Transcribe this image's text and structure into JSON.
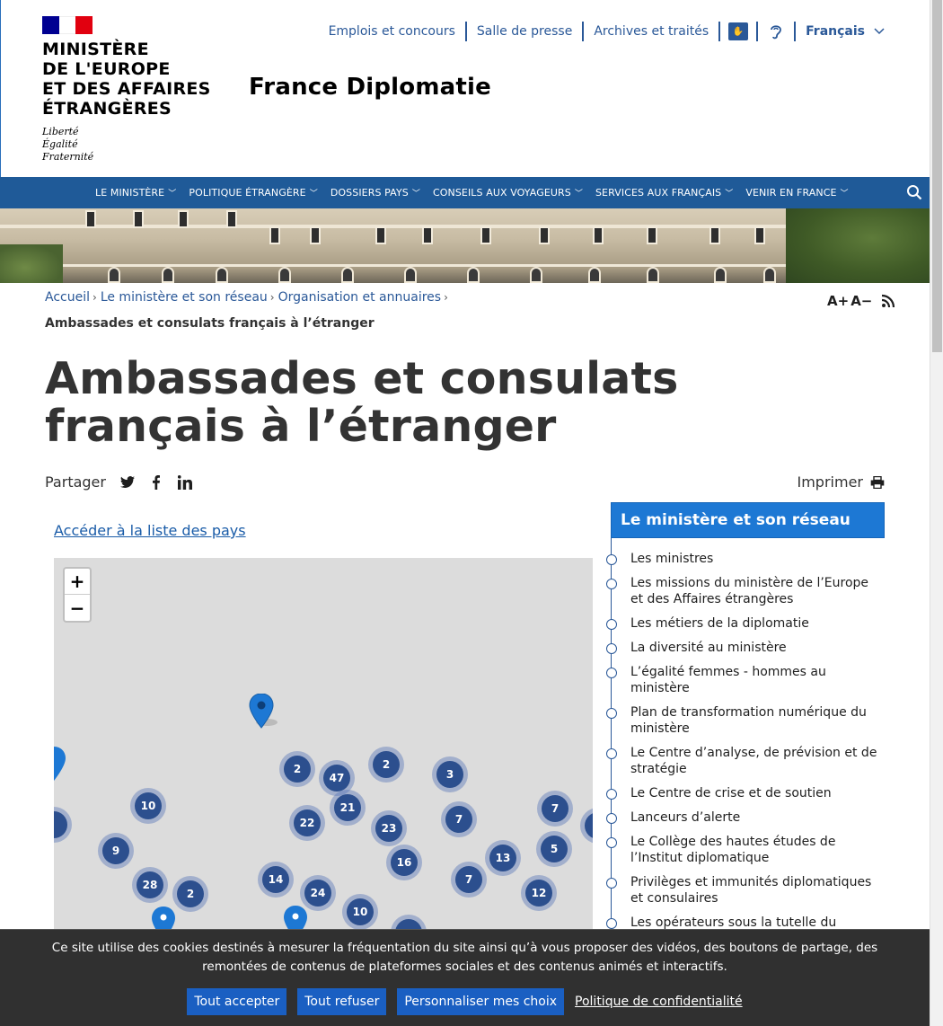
{
  "header": {
    "ministry_lines": [
      "MINISTÈRE",
      "DE L'EUROPE",
      "ET DES AFFAIRES",
      "ÉTRANGÈRES"
    ],
    "motto_lines": [
      "Liberté",
      "Égalité",
      "Fraternité"
    ],
    "site_name": "France Diplomatie",
    "top_links": [
      "Emplois et concours",
      "Salle de presse",
      "Archives et traités"
    ],
    "language": "Français"
  },
  "nav": {
    "items": [
      "LE MINISTÈRE",
      "POLITIQUE ÉTRANGÈRE",
      "DOSSIERS PAYS",
      "CONSEILS AUX VOYAGEURS",
      "SERVICES AUX FRANÇAIS",
      "VENIR EN FRANCE"
    ]
  },
  "breadcrumb": {
    "items": [
      "Accueil",
      "Le ministère et son réseau",
      "Organisation et annuaires"
    ],
    "current": "Ambassades et consulats français à l’étranger"
  },
  "tools": {
    "font_increase": "A+",
    "font_decrease": "A−"
  },
  "page": {
    "title": "Ambassades et consulats français à l’étranger",
    "share_label": "Partager",
    "print_label": "Imprimer",
    "country_list_link": "Accéder à la liste des pays"
  },
  "map": {
    "zoom_in": "+",
    "zoom_out": "−",
    "clusters": [
      "2",
      "47",
      "2",
      "3",
      "10",
      "21",
      "22",
      "23",
      "7",
      "7",
      "9",
      "16",
      "13",
      "5",
      "28",
      "2",
      "14",
      "24",
      "7",
      "12",
      "10"
    ]
  },
  "sidebar": {
    "title": "Le ministère et son réseau",
    "items": [
      "Les ministres",
      "Les missions du ministère de l’Europe et des Affaires étrangères",
      "Les métiers de la diplomatie",
      "La diversité au ministère",
      "L’égalité femmes - hommes au ministère",
      "Plan de transformation numérique du ministère",
      "Le Centre d’analyse, de prévision et de stratégie",
      "Le Centre de crise et de soutien",
      "Lanceurs d’alerte",
      "Le Collège des hautes études de l’Institut diplomatique",
      "Privilèges et immunités diplomatiques et consulaires",
      "Les opérateurs sous la tutelle du"
    ]
  },
  "cookie": {
    "text": "Ce site utilise des cookies destinés à mesurer la fréquentation du site ainsi qu’à vous proposer des vidéos, des boutons de partage, des remontées de contenus de plateformes sociales et des contenus animés et interactifs.",
    "accept": "Tout accepter",
    "refuse": "Tout refuser",
    "customize": "Personnaliser mes choix",
    "privacy": "Politique de confidentialité"
  },
  "colors": {
    "nav_bg": "#1f5a98",
    "link": "#2a5898",
    "sidebar_head": "#1d78d4",
    "cluster": "#2c4f8e",
    "cookie_bg": "#303030",
    "cookie_btn": "#1a5fc2"
  }
}
